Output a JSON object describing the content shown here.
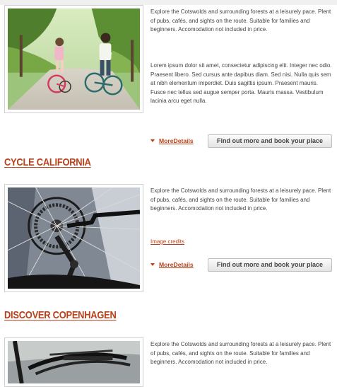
{
  "tours": [
    {
      "title": "",
      "image_alt": "Children cycling along a park path",
      "description": "Explore the Cotswolds and surrounding forests at a leisurely pace. Plent of pubs, cafés, and sights on the route. Suitable for families and beginners. Accomodation not included in price.",
      "extra": "Lorem ipsum dolor sit amet, consectetur adipiscing elit. Integer nec odio. Praesent libero. Sed cursus ante dapibus diam. Sed nisi. Nulla quis sem at nibh elementum imperdiet. Duis sagittis ipsum. Praesent mauris. Fusce nec tellus sed augue semper porta. Mauris massa. Vestibulum lacinia arcu eget nulla.",
      "more_label": "MoreDetails",
      "book_label": "Find out more and book your place"
    },
    {
      "title": "CYCLE CALIFORNIA",
      "image_alt": "Close-up of a bicycle rear derailleur and wheel",
      "description": "Explore the Cotswolds and surrounding forests at a leisurely pace. Plent of pubs, cafés, and sights on the route. Suitable for families and beginners. Accomodation not included in price.",
      "credits_label": "Image credits",
      "more_label": "MoreDetails",
      "book_label": "Find out more and book your place"
    },
    {
      "title": "DISCOVER COPENHAGEN",
      "image_alt": "Bicycle rear rack",
      "description": "Explore the Cotswolds and surrounding forests at a leisurely pace. Plent of pubs, cafés, and sights on the route. Suitable for families and beginners. Accomodation not included in price."
    }
  ],
  "colors": {
    "accent": "#b8401a",
    "text": "#444444",
    "button_border": "#bdbdbd"
  },
  "icons": {
    "more_details": "caret-down-icon"
  }
}
